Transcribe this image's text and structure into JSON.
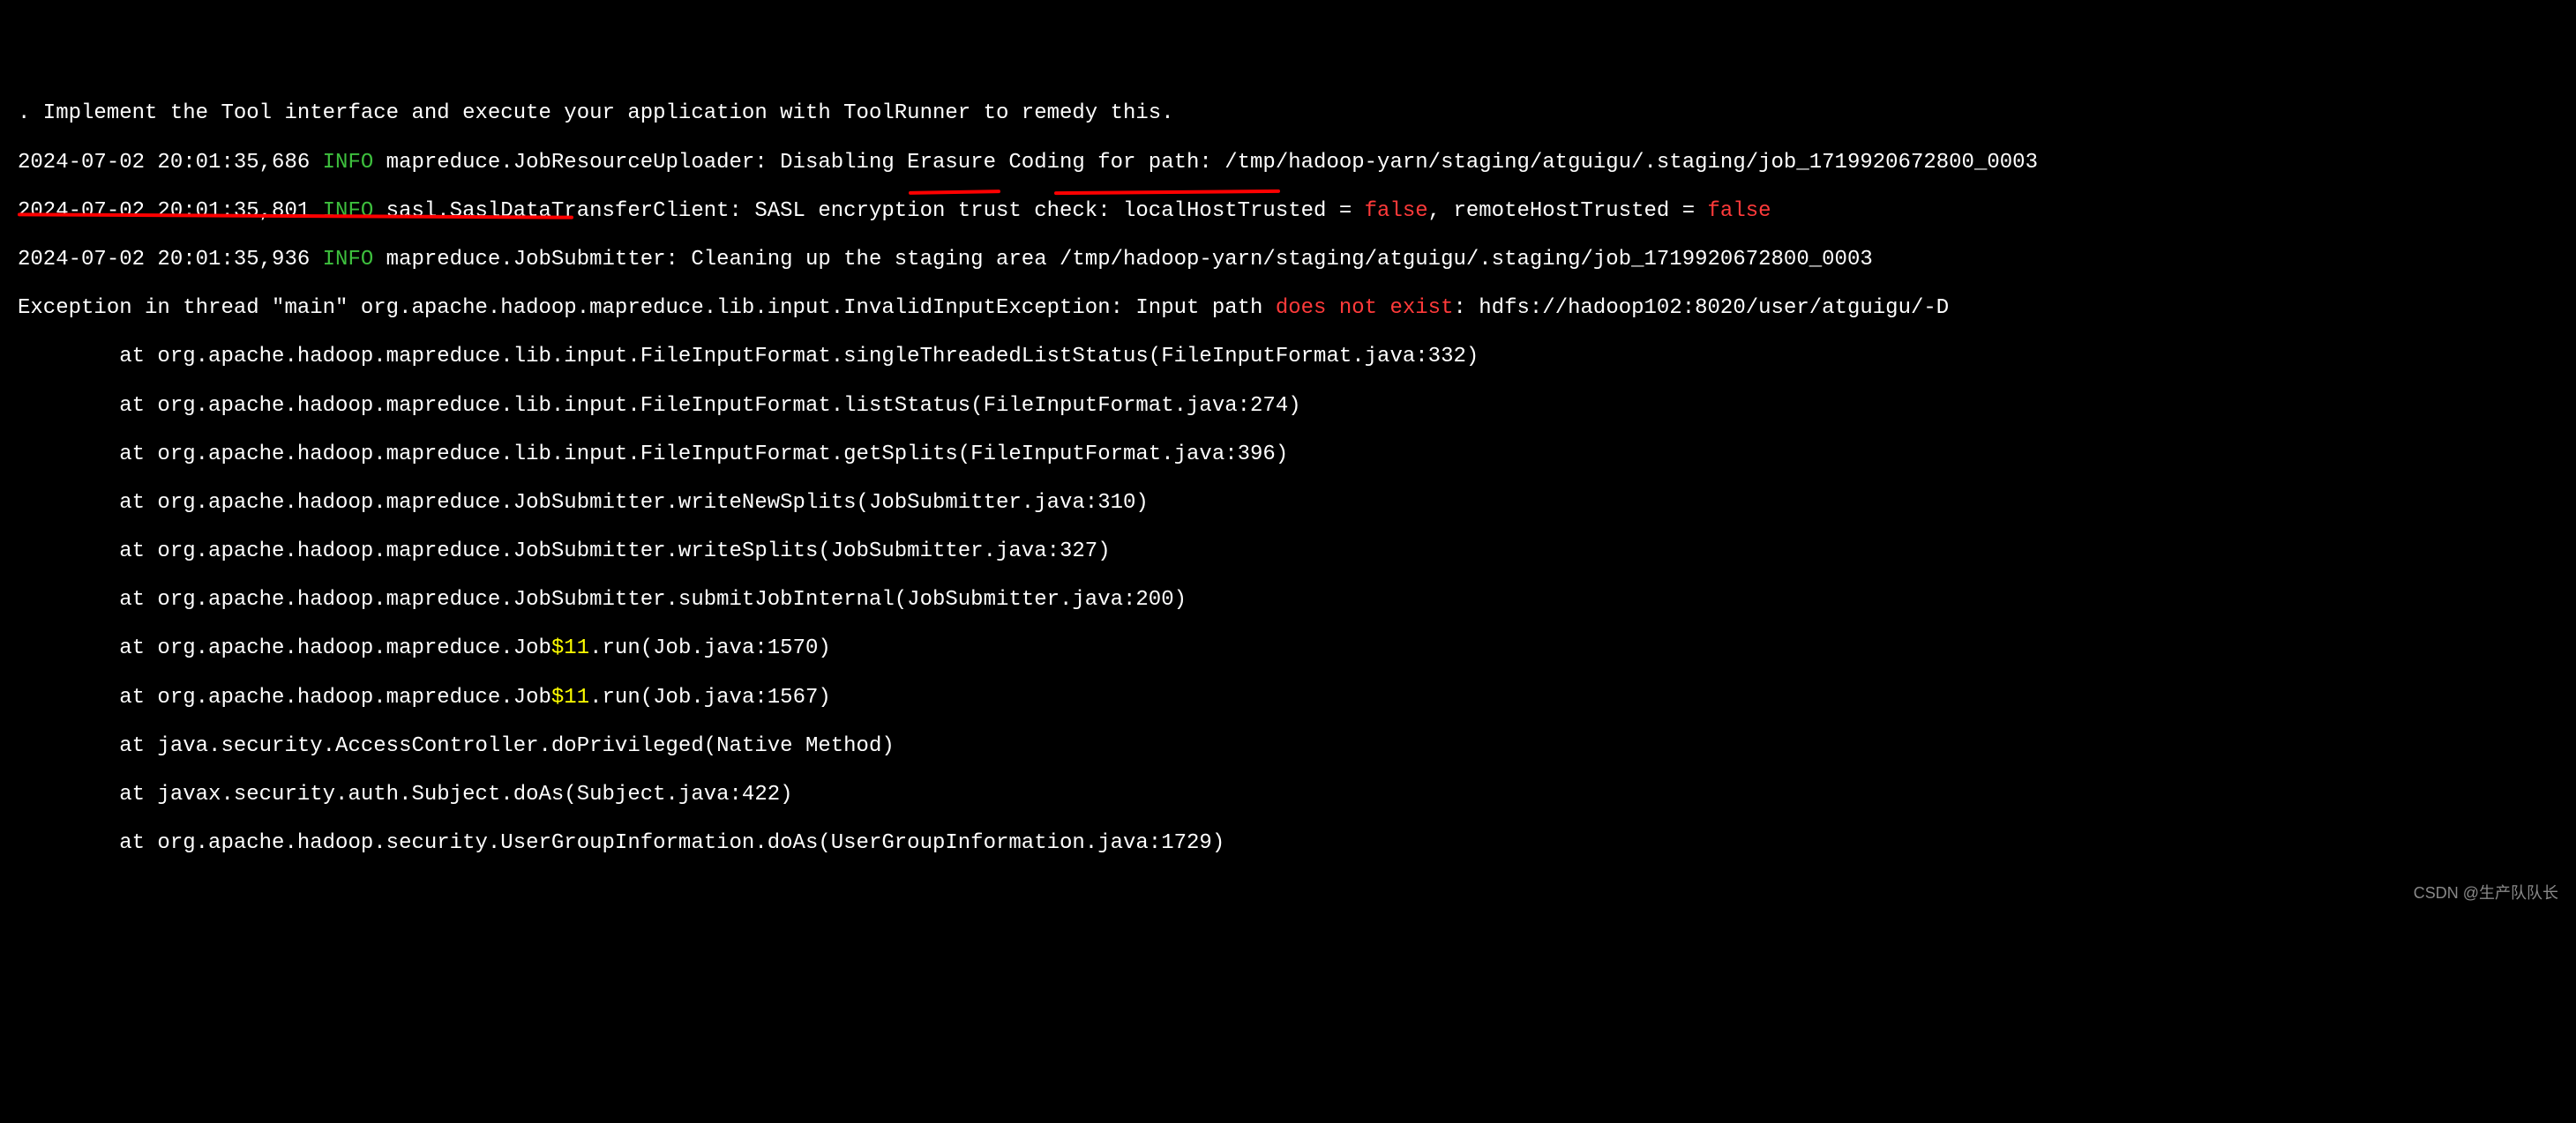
{
  "terminal": {
    "line0": ". Implement the Tool interface and execute your application with ToolRunner to remedy this.",
    "line1_ts": "2024-07-02 20:01:35,686 ",
    "line1_level": "INFO",
    "line1_msg": " mapreduce.JobResourceUploader: Disabling Erasure Coding for path: /tmp/hadoop-yarn/staging/atguigu/.staging/job_1719920672800_0003",
    "line2_ts": "2024-07-02 20:01:35,801 ",
    "line2_level": "INFO",
    "line2_msg": " sasl.SaslDataTransferClient: SASL encryption trust check: localHostTrusted = ",
    "line2_false1": "false",
    "line2_mid": ", remoteHostTrusted = ",
    "line2_false2": "false",
    "line3_ts": "2024-07-02 20:01:35,936 ",
    "line3_level": "INFO",
    "line3_msg": " mapreduce.JobSubmitter: Cleaning up the staging area /tmp/hadoop-yarn/staging/atguigu/.staging/job_1719920672800_0003",
    "exception_pre": "Exception in thread \"main\" org.apache.hadoop.mapreduce.lib.input.InvalidInputException: Input path ",
    "exception_err": "does not exist",
    "exception_post": ": hdfs://hadoop102:8020/user/atguigu/-D",
    "stack0": "        at org.apache.hadoop.mapreduce.lib.input.FileInputFormat.singleThreadedListStatus(FileInputFormat.java:332)",
    "stack1": "        at org.apache.hadoop.mapreduce.lib.input.FileInputFormat.listStatus(FileInputFormat.java:274)",
    "stack2": "        at org.apache.hadoop.mapreduce.lib.input.FileInputFormat.getSplits(FileInputFormat.java:396)",
    "stack3": "        at org.apache.hadoop.mapreduce.JobSubmitter.writeNewSplits(JobSubmitter.java:310)",
    "stack4": "        at org.apache.hadoop.mapreduce.JobSubmitter.writeSplits(JobSubmitter.java:327)",
    "stack5": "        at org.apache.hadoop.mapreduce.JobSubmitter.submitJobInternal(JobSubmitter.java:200)",
    "stack6_pre": "        at org.apache.hadoop.mapreduce.Job",
    "stack6_dollar": "$11",
    "stack6_post": ".run(Job.java:1570)",
    "stack7_pre": "        at org.apache.hadoop.mapreduce.Job",
    "stack7_dollar": "$11",
    "stack7_post": ".run(Job.java:1567)",
    "stack8": "        at java.security.AccessController.doPrivileged(Native Method)",
    "stack9": "        at javax.security.auth.Subject.doAs(Subject.java:422)",
    "stack10": "        at org.apache.hadoop.security.UserGroupInformation.doAs(UserGroupInformation.java:1729)"
  },
  "watermark": "CSDN @生产队队长"
}
